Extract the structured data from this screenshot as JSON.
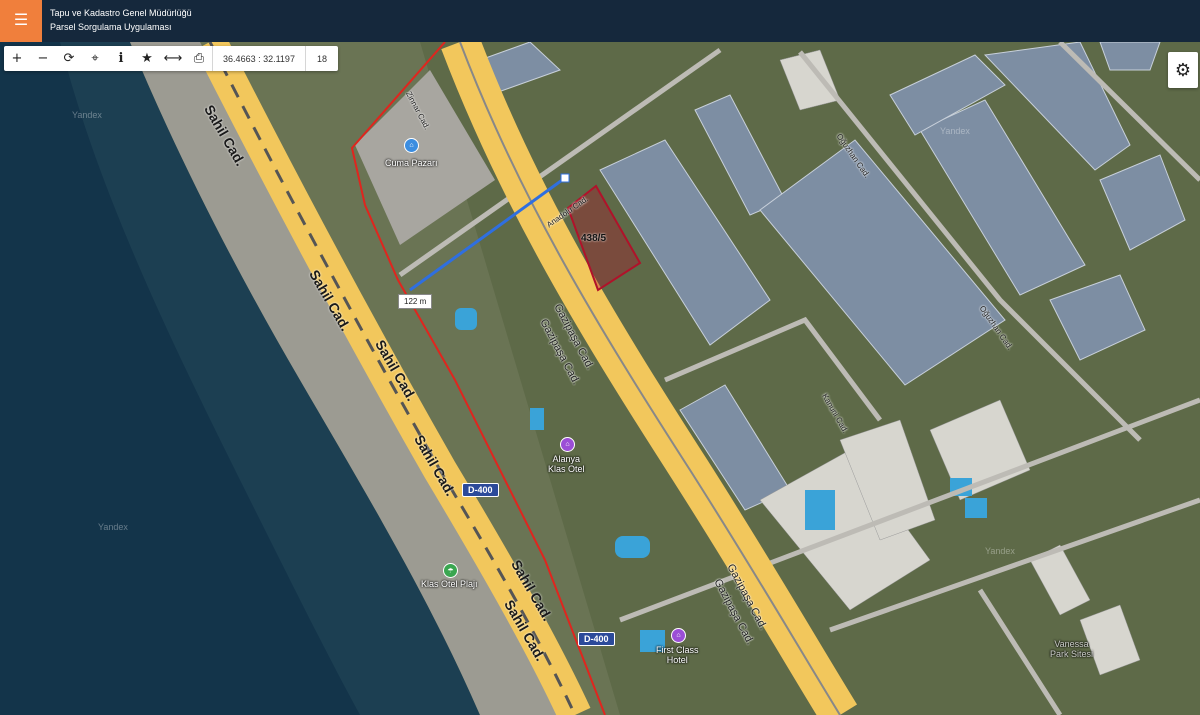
{
  "header": {
    "menu_icon": "hamburger-icon",
    "title_line1": "Tapu ve Kadastro Genel Müdürlüğü",
    "title_line2": "Parsel Sorgulama Uygulaması"
  },
  "toolbar": {
    "zoom_in": "+",
    "zoom_out": "−",
    "refresh": "⟳",
    "locate": "⌖",
    "info": "i",
    "favorite": "★",
    "measure": "⟷",
    "print": "⎙",
    "coordinates": "36.4663 : 32.1197",
    "zoom_level": "18"
  },
  "settings_icon": "⚙",
  "measurement": "122 m",
  "parcel": {
    "id": "438/5"
  },
  "map_labels": {
    "sahil": "Sahil Cad.",
    "gazipasa": "Gazipaşa Cad.",
    "zinnar": "Zinnar Cad.",
    "anadolu": "Anadolu Cad.",
    "oguzhan": "Oğuzhan Cad.",
    "kanuni": "Kanuni Cad.",
    "road_shield": "D-400",
    "cuma_pazari": "Cuma Pazarı",
    "alanya_klas": "Alanya\nKlas Otel",
    "klas_plaji": "Klas Otel Plajı",
    "first_class": "First Class\nHotel",
    "vanessa": "Vanessa\nPark Sitesi",
    "yandex": "Yandex"
  },
  "colors": {
    "header_bg": "#15283c",
    "menu_btn": "#f07f3c",
    "parcel_outline": "#b0122a",
    "boundary_red": "#e0251e",
    "measure_blue": "#2f6fe0",
    "highway": "#f2c75c"
  }
}
